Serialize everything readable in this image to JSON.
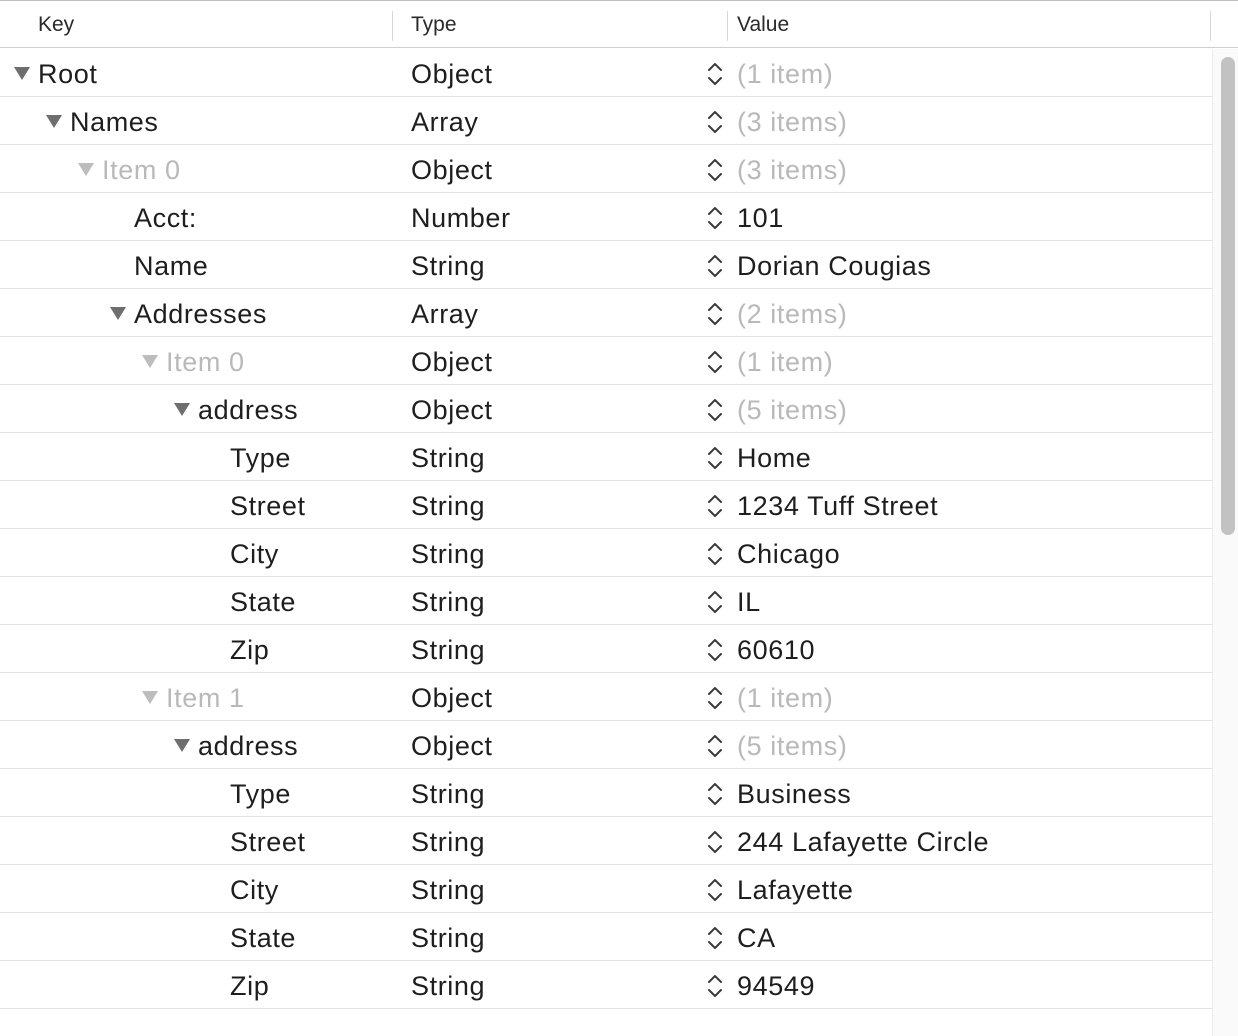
{
  "header": {
    "key_label": "Key",
    "type_label": "Type",
    "value_label": "Value"
  },
  "rows": [
    {
      "key": "Root",
      "type": "Object",
      "value": "(1 item)",
      "level": 0,
      "expandable": true,
      "dim_key": false,
      "dim_value": true
    },
    {
      "key": "Names",
      "type": "Array",
      "value": "(3 items)",
      "level": 1,
      "expandable": true,
      "dim_key": false,
      "dim_value": true
    },
    {
      "key": "Item 0",
      "type": "Object",
      "value": "(3 items)",
      "level": 2,
      "expandable": true,
      "dim_key": true,
      "dim_value": true
    },
    {
      "key": "Acct:",
      "type": "Number",
      "value": "101",
      "level": 3,
      "expandable": false,
      "dim_key": false,
      "dim_value": false
    },
    {
      "key": "Name",
      "type": "String",
      "value": "Dorian Cougias",
      "level": 3,
      "expandable": false,
      "dim_key": false,
      "dim_value": false
    },
    {
      "key": "Addresses",
      "type": "Array",
      "value": "(2 items)",
      "level": 3,
      "expandable": true,
      "dim_key": false,
      "dim_value": true
    },
    {
      "key": "Item 0",
      "type": "Object",
      "value": "(1 item)",
      "level": 4,
      "expandable": true,
      "dim_key": true,
      "dim_value": true
    },
    {
      "key": "address",
      "type": "Object",
      "value": "(5 items)",
      "level": 5,
      "expandable": true,
      "dim_key": false,
      "dim_value": true
    },
    {
      "key": "Type",
      "type": "String",
      "value": "Home",
      "level": 6,
      "expandable": false,
      "dim_key": false,
      "dim_value": false
    },
    {
      "key": "Street",
      "type": "String",
      "value": "1234 Tuff Street",
      "level": 6,
      "expandable": false,
      "dim_key": false,
      "dim_value": false
    },
    {
      "key": "City",
      "type": "String",
      "value": "Chicago",
      "level": 6,
      "expandable": false,
      "dim_key": false,
      "dim_value": false
    },
    {
      "key": "State",
      "type": "String",
      "value": "IL",
      "level": 6,
      "expandable": false,
      "dim_key": false,
      "dim_value": false
    },
    {
      "key": "Zip",
      "type": "String",
      "value": "60610",
      "level": 6,
      "expandable": false,
      "dim_key": false,
      "dim_value": false
    },
    {
      "key": "Item 1",
      "type": "Object",
      "value": "(1 item)",
      "level": 4,
      "expandable": true,
      "dim_key": true,
      "dim_value": true
    },
    {
      "key": "address",
      "type": "Object",
      "value": "(5 items)",
      "level": 5,
      "expandable": true,
      "dim_key": false,
      "dim_value": true
    },
    {
      "key": "Type",
      "type": "String",
      "value": "Business",
      "level": 6,
      "expandable": false,
      "dim_key": false,
      "dim_value": false
    },
    {
      "key": "Street",
      "type": "String",
      "value": "244 Lafayette Circle",
      "level": 6,
      "expandable": false,
      "dim_key": false,
      "dim_value": false
    },
    {
      "key": "City",
      "type": "String",
      "value": "Lafayette",
      "level": 6,
      "expandable": false,
      "dim_key": false,
      "dim_value": false
    },
    {
      "key": "State",
      "type": "String",
      "value": "CA",
      "level": 6,
      "expandable": false,
      "dim_key": false,
      "dim_value": false
    },
    {
      "key": "Zip",
      "type": "String",
      "value": "94549",
      "level": 6,
      "expandable": false,
      "dim_key": false,
      "dim_value": false
    }
  ],
  "colors": {
    "dim_text": "#b9b9b9",
    "text": "#1e1e1e",
    "disclosure": "#6e6e6e"
  },
  "icons": {
    "disclosure": "disclosure-triangle-icon",
    "stepper": "up-down-stepper-icon"
  }
}
